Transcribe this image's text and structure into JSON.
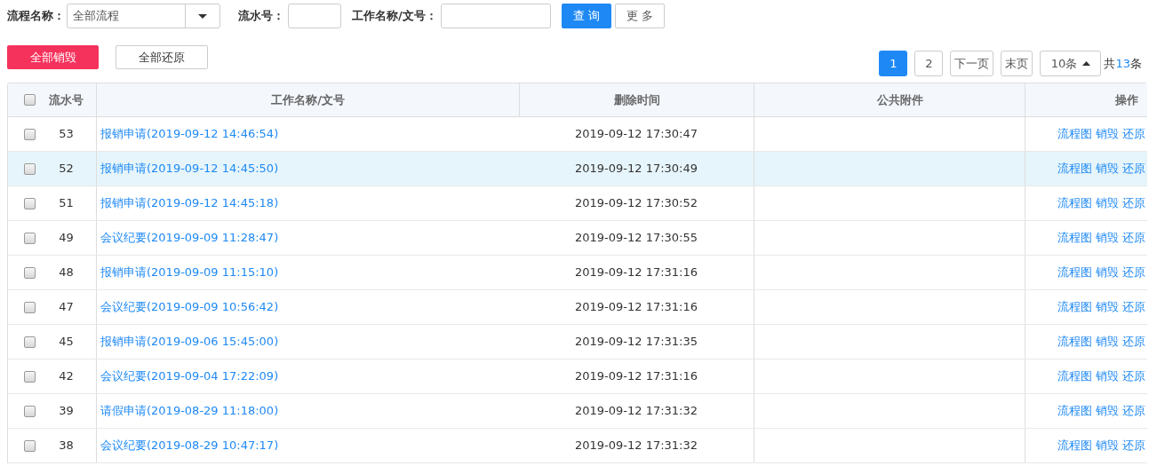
{
  "filters": {
    "process_label": "流程名称：",
    "process_value": "全部流程",
    "serial_label": "流水号：",
    "name_label": "工作名称/文号：",
    "query_button": "查 询",
    "more_button": "更 多"
  },
  "actions": {
    "destroy_all": "全部销毁",
    "restore_all": "全部还原"
  },
  "pagination": {
    "pages": [
      {
        "label": "1",
        "selected": true
      },
      {
        "label": "2",
        "selected": false
      }
    ],
    "next": "下一页",
    "last": "末页",
    "page_size": "10条",
    "total_prefix": "共",
    "total_count": "13",
    "total_suffix": "条"
  },
  "table": {
    "columns": [
      "流水号",
      "工作名称/文号",
      "删除时间",
      "公共附件",
      "操作"
    ],
    "select_all_checked": false,
    "rows": [
      {
        "checked": false,
        "highlighted": false,
        "serial": "53",
        "name": "报销申请(2019-09-12 14:46:54)",
        "deleted_at": "2019-09-12 17:30:47",
        "ops": [
          "流程图",
          "销毁",
          "还原"
        ]
      },
      {
        "checked": false,
        "highlighted": true,
        "serial": "52",
        "name": "报销申请(2019-09-12 14:45:50)",
        "deleted_at": "2019-09-12 17:30:49",
        "ops": [
          "流程图",
          "销毁",
          "还原"
        ]
      },
      {
        "checked": false,
        "highlighted": false,
        "serial": "51",
        "name": "报销申请(2019-09-12 14:45:18)",
        "deleted_at": "2019-09-12 17:30:52",
        "ops": [
          "流程图",
          "销毁",
          "还原"
        ]
      },
      {
        "checked": false,
        "highlighted": false,
        "serial": "49",
        "name": "会议纪要(2019-09-09 11:28:47)",
        "deleted_at": "2019-09-12 17:30:55",
        "ops": [
          "流程图",
          "销毁",
          "还原"
        ]
      },
      {
        "checked": false,
        "highlighted": false,
        "serial": "48",
        "name": "报销申请(2019-09-09 11:15:10)",
        "deleted_at": "2019-09-12 17:31:16",
        "ops": [
          "流程图",
          "销毁",
          "还原"
        ]
      },
      {
        "checked": false,
        "highlighted": false,
        "serial": "47",
        "name": "会议纪要(2019-09-09 10:56:42)",
        "deleted_at": "2019-09-12 17:31:16",
        "ops": [
          "流程图",
          "销毁",
          "还原"
        ]
      },
      {
        "checked": false,
        "highlighted": false,
        "serial": "45",
        "name": "报销申请(2019-09-06 15:45:00)",
        "deleted_at": "2019-09-12 17:31:35",
        "ops": [
          "流程图",
          "销毁",
          "还原"
        ]
      },
      {
        "checked": false,
        "highlighted": false,
        "serial": "42",
        "name": "会议纪要(2019-09-04 17:22:09)",
        "deleted_at": "2019-09-12 17:31:16",
        "ops": [
          "流程图",
          "销毁",
          "还原"
        ]
      },
      {
        "checked": false,
        "highlighted": false,
        "serial": "39",
        "name": "请假申请(2019-08-29 11:18:00)",
        "deleted_at": "2019-09-12 17:31:32",
        "ops": [
          "流程图",
          "销毁",
          "还原"
        ]
      },
      {
        "checked": false,
        "highlighted": false,
        "serial": "38",
        "name": "会议纪要(2019-08-29 10:47:17)",
        "deleted_at": "2019-09-12 17:31:32",
        "ops": [
          "流程图",
          "销毁",
          "还原"
        ]
      }
    ]
  }
}
